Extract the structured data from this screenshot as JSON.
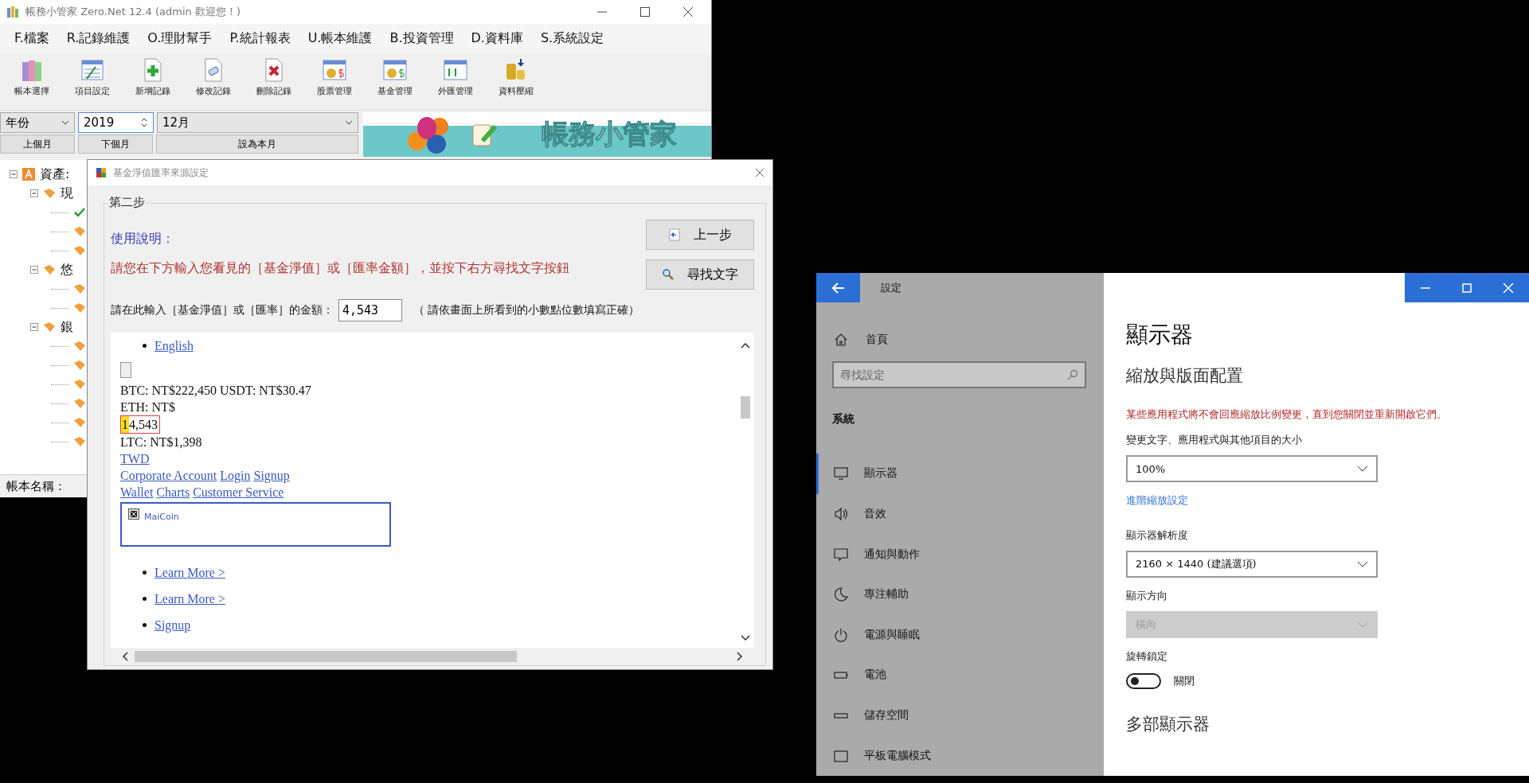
{
  "app_window": {
    "title": "帳務小管家 Zero.Net 12.4 (admin 歡迎您！)",
    "menu": [
      "F.檔案",
      "R.記錄維護",
      "O.理財幫手",
      "P.統計報表",
      "U.帳本維護",
      "B.投資管理",
      "D.資料庫",
      "S.系統設定"
    ],
    "toolbar": [
      "帳本選擇",
      "項目設定",
      "新增記錄",
      "修改記錄",
      "刪除記錄",
      "股票管理",
      "基金管理",
      "外匯管理",
      "資料壓縮"
    ],
    "period_type": "年份",
    "year": "2019",
    "month": "12月",
    "nav_buttons": [
      "上個月",
      "下個月",
      "設為本月"
    ],
    "banner": {
      "title": "帳務小管家"
    },
    "tree": [
      {
        "label": "資產:",
        "kind": "root",
        "expanded": true,
        "children": [
          {
            "label": "現",
            "kind": "tag",
            "expanded": true,
            "children": [
              {
                "kind": "check"
              },
              {
                "kind": "tag"
              },
              {
                "kind": "tag"
              }
            ]
          },
          {
            "label": "悠",
            "kind": "tag",
            "expanded": true,
            "children": [
              {
                "kind": "tag"
              },
              {
                "kind": "tag"
              }
            ]
          },
          {
            "label": "銀",
            "kind": "tag",
            "expanded": true,
            "children": [
              {
                "kind": "tag"
              },
              {
                "kind": "tag"
              },
              {
                "kind": "tag"
              },
              {
                "kind": "tag"
              },
              {
                "kind": "tag"
              },
              {
                "kind": "tag"
              }
            ]
          }
        ]
      }
    ],
    "status_label": "帳本名稱："
  },
  "dialog": {
    "title": "基金淨值匯率來源設定",
    "group": "第二步",
    "help_title": "使用說明：",
    "instruction": "請您在下方輸入您看見的［基金淨值］或［匯率金額］，並按下右方尋找文字按鈕",
    "prompt": "請在此輸入［基金淨值］或［匯率］的金額：",
    "amount": "4,543",
    "hint": "（ 請依畫面上所看到的小數點位數填寫正確）",
    "buttons": [
      "上一步",
      "尋找文字"
    ],
    "web_lines": [
      {
        "kind": "bullet_link",
        "text": "English"
      },
      {
        "kind": "broken_image"
      },
      {
        "kind": "text",
        "text": "BTC: NT$222,450 USDT: NT$30.47"
      },
      {
        "kind": "text",
        "text": "ETH: NT$"
      },
      {
        "kind": "match",
        "mark": "1",
        "text": "4,543"
      },
      {
        "kind": "text",
        "text": "LTC: NT$1,398"
      },
      {
        "kind": "links",
        "links": [
          "TWD"
        ]
      },
      {
        "kind": "links",
        "links": [
          "Corporate Account",
          "Login",
          "Signup"
        ]
      },
      {
        "kind": "links",
        "links": [
          "Wallet",
          "Charts",
          "Customer Service"
        ]
      },
      {
        "kind": "card",
        "text": "MaiCoin"
      },
      {
        "kind": "bullet_link",
        "text": "Learn More >"
      },
      {
        "kind": "bullet_link",
        "text": "Learn More >"
      },
      {
        "kind": "bullet_link",
        "text": "Signup"
      }
    ]
  },
  "settings": {
    "title": "設定",
    "home": "首頁",
    "search_placeholder": "尋找設定",
    "section": "系統",
    "nav": [
      {
        "label": "顯示器",
        "selected": true
      },
      {
        "label": "音效",
        "selected": false
      },
      {
        "label": "通知與動作",
        "selected": false
      },
      {
        "label": "專注輔助",
        "selected": false
      },
      {
        "label": "電源與睡眠",
        "selected": false
      },
      {
        "label": "電池",
        "selected": false
      },
      {
        "label": "儲存空間",
        "selected": false
      },
      {
        "label": "平板電腦模式",
        "selected": false
      }
    ],
    "page_title": "顯示器",
    "subtitle": "縮放與版面配置",
    "warning": "某些應用程式將不會回應縮放比例變更，直到您關閉並重新開啟它們。",
    "fields": [
      {
        "kind": "dropdown",
        "label": "變更文字、應用程式與其他項目的大小",
        "value": "100%",
        "disabled": false
      },
      {
        "kind": "link",
        "text": "進階縮放設定"
      },
      {
        "kind": "dropdown",
        "label": "顯示器解析度",
        "value": "2160 × 1440 (建議選項)",
        "disabled": false
      },
      {
        "kind": "dropdown",
        "label": "顯示方向",
        "value": "橫向",
        "disabled": true
      },
      {
        "kind": "toggle",
        "label": "旋轉鎖定",
        "on": false,
        "state_text": "關閉"
      }
    ],
    "next_heading": "多部顯示器"
  }
}
